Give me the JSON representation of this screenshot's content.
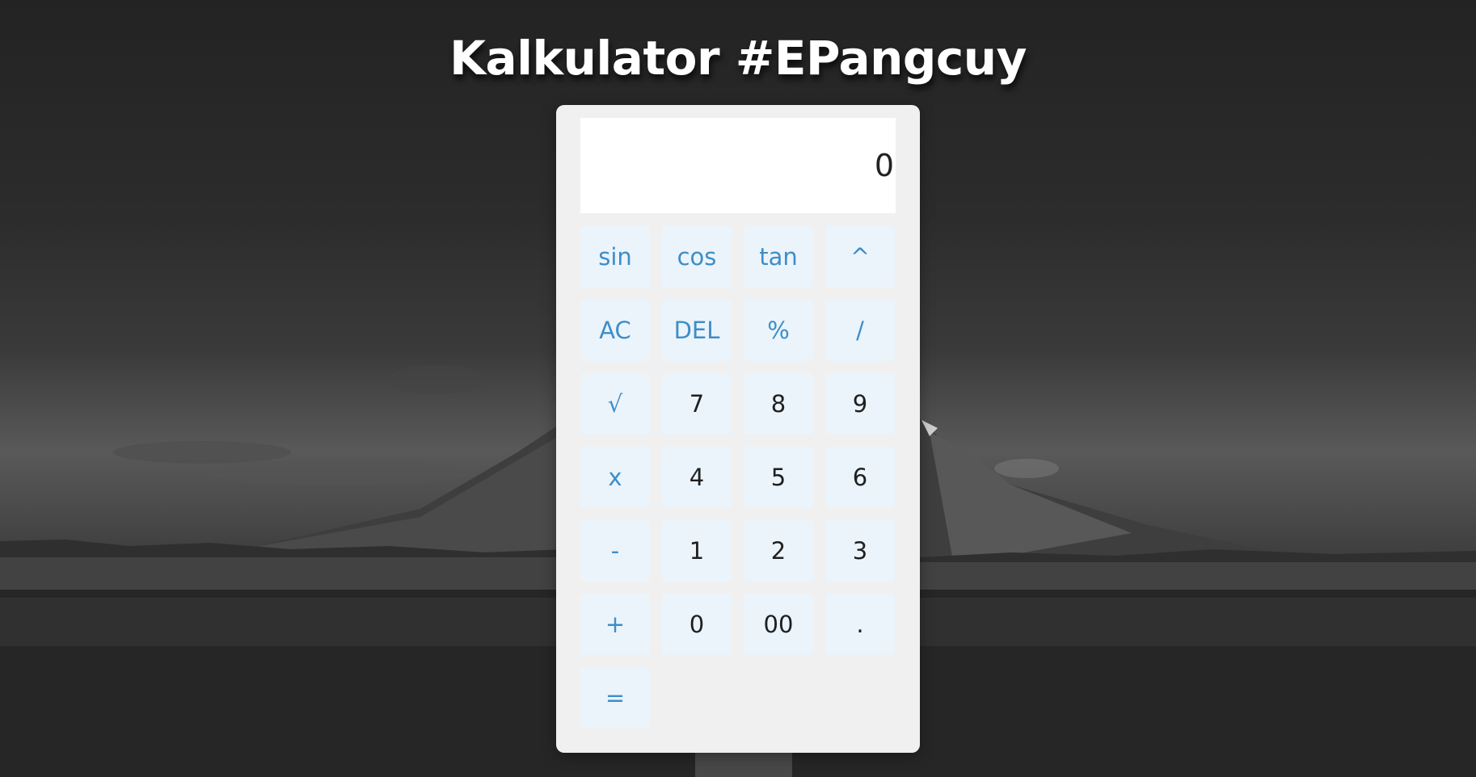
{
  "page": {
    "title": "Kalkulator #EPangcuy"
  },
  "calculator": {
    "display_value": "0",
    "colors": {
      "function_text": "#3d8ec9",
      "number_text": "#1f1f1f",
      "button_bg": "#ebf4fb",
      "panel_bg": "#f0f0f0"
    },
    "rows": [
      [
        {
          "label": "sin",
          "kind": "fn",
          "name": "sin-button"
        },
        {
          "label": "cos",
          "kind": "fn",
          "name": "cos-button"
        },
        {
          "label": "tan",
          "kind": "fn",
          "name": "tan-button"
        },
        {
          "label": "^",
          "kind": "fn",
          "name": "power-button"
        }
      ],
      [
        {
          "label": "AC",
          "kind": "fn",
          "name": "all-clear-button"
        },
        {
          "label": "DEL",
          "kind": "fn",
          "name": "delete-button"
        },
        {
          "label": "%",
          "kind": "fn",
          "name": "percent-button"
        },
        {
          "label": "/",
          "kind": "fn",
          "name": "divide-button"
        }
      ],
      [
        {
          "label": "√",
          "kind": "fn",
          "name": "square-root-button"
        },
        {
          "label": "7",
          "kind": "num",
          "name": "digit-7-button"
        },
        {
          "label": "8",
          "kind": "num",
          "name": "digit-8-button"
        },
        {
          "label": "9",
          "kind": "num",
          "name": "digit-9-button"
        }
      ],
      [
        {
          "label": "x",
          "kind": "fn",
          "name": "multiply-button"
        },
        {
          "label": "4",
          "kind": "num",
          "name": "digit-4-button"
        },
        {
          "label": "5",
          "kind": "num",
          "name": "digit-5-button"
        },
        {
          "label": "6",
          "kind": "num",
          "name": "digit-6-button"
        }
      ],
      [
        {
          "label": "-",
          "kind": "fn",
          "name": "subtract-button"
        },
        {
          "label": "1",
          "kind": "num",
          "name": "digit-1-button"
        },
        {
          "label": "2",
          "kind": "num",
          "name": "digit-2-button"
        },
        {
          "label": "3",
          "kind": "num",
          "name": "digit-3-button"
        }
      ],
      [
        {
          "label": "+",
          "kind": "fn",
          "name": "add-button"
        },
        {
          "label": "0",
          "kind": "num",
          "name": "digit-0-button"
        },
        {
          "label": "00",
          "kind": "num",
          "name": "double-zero-button"
        },
        {
          "label": ".",
          "kind": "num",
          "name": "decimal-point-button"
        }
      ],
      [
        {
          "label": "=",
          "kind": "fn",
          "name": "equals-button"
        }
      ]
    ]
  }
}
